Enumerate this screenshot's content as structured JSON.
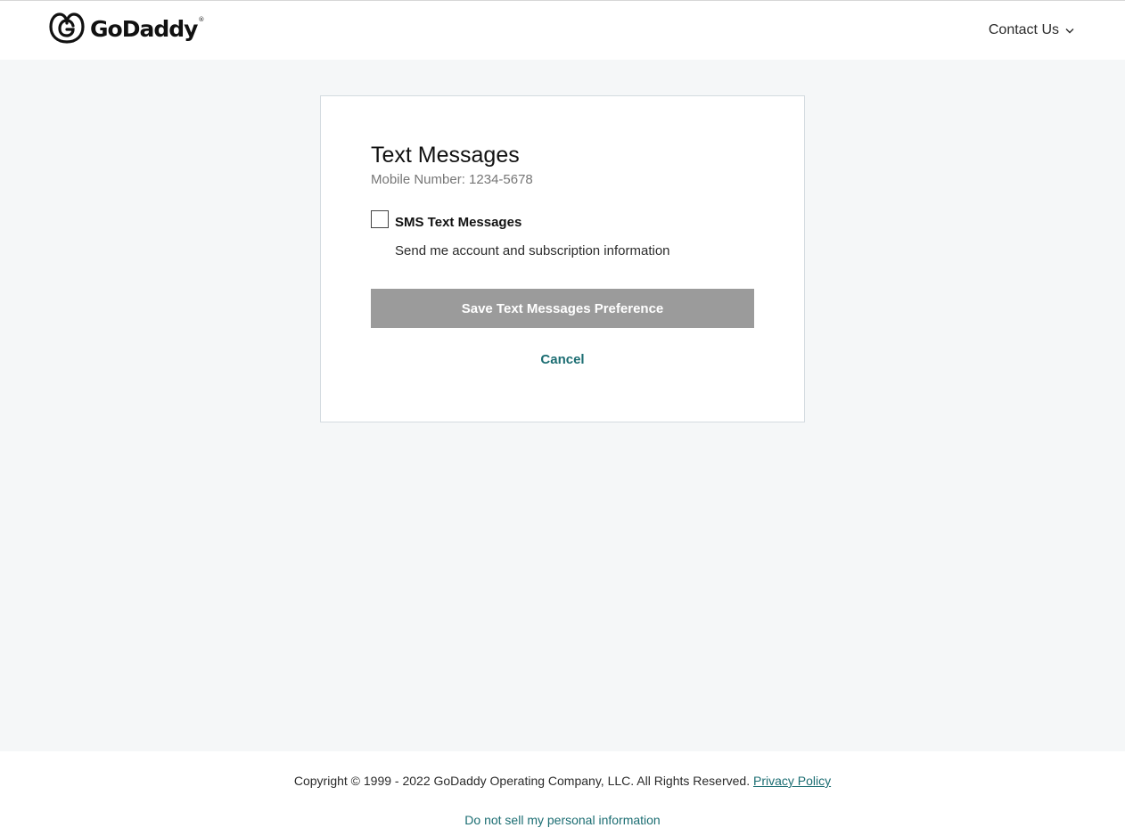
{
  "header": {
    "logo_text": "GoDaddy",
    "logo_mark_icon": "godaddy-logo-icon",
    "contact_label": "Contact Us",
    "contact_icon": "chevron-down-icon"
  },
  "card": {
    "title": "Text Messages",
    "subtitle": "Mobile Number: 1234-5678",
    "checkbox_label": "SMS Text Messages",
    "checkbox_checked": false,
    "checkbox_description": "Send me account and subscription information",
    "save_label": "Save Text Messages Preference",
    "cancel_label": "Cancel"
  },
  "footer": {
    "copyright": "Copyright © 1999 - 2022 GoDaddy Operating Company, LLC. All Rights Reserved.",
    "privacy_label": "Privacy Policy",
    "donotsell_label": "Do not sell my personal information"
  },
  "colors": {
    "page_bg": "#f5f7f8",
    "link": "#1b6d72",
    "button_disabled": "#9b9b9b"
  }
}
